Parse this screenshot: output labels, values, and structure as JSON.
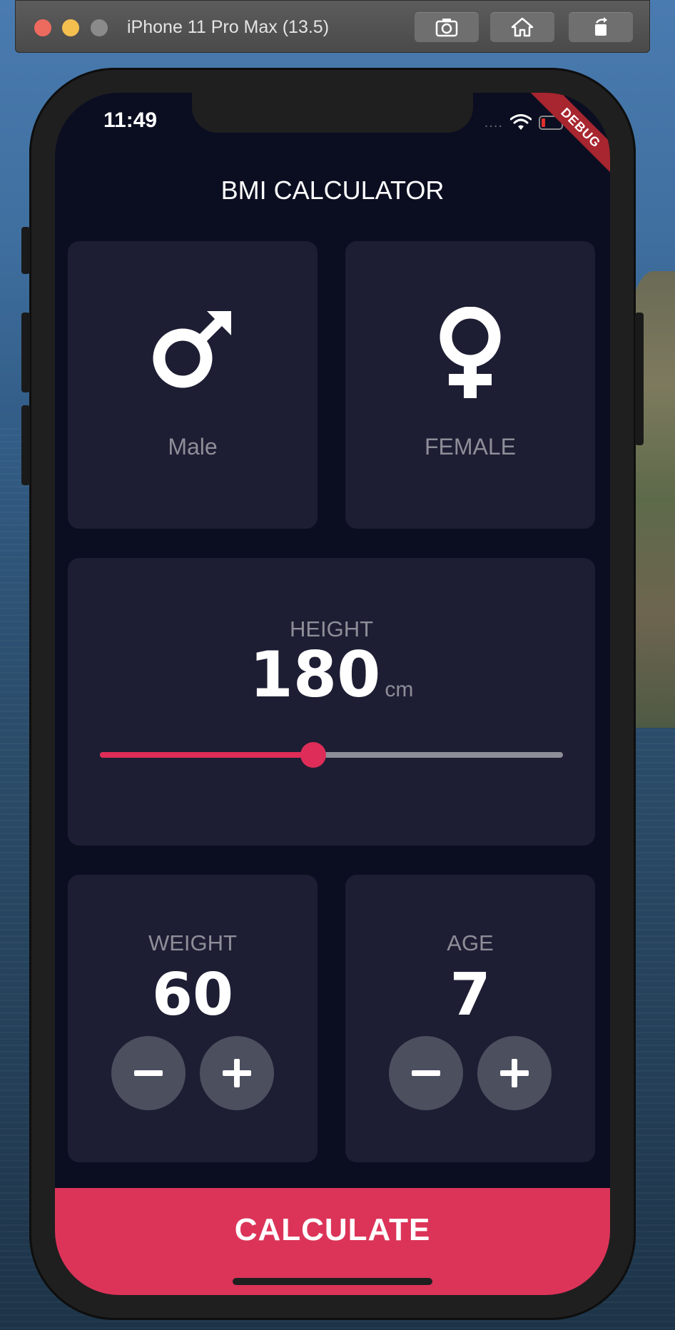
{
  "simulator": {
    "title": "iPhone 11 Pro Max (13.5)",
    "buttons": [
      "screenshot-icon",
      "home-icon",
      "rotate-icon"
    ]
  },
  "status_bar": {
    "time": "11:49",
    "signal": "....",
    "debug": "DEBUG"
  },
  "app": {
    "title": "BMI CALCULATOR",
    "male_label": "Male",
    "female_label": "FEMALE",
    "height": {
      "label": "HEIGHT",
      "value": "180",
      "unit": "cm",
      "slider_fraction": 0.46
    },
    "weight": {
      "label": "WEIGHT",
      "value": "60"
    },
    "age": {
      "label": "AGE",
      "value": "7"
    },
    "calculate_label": "CALCULATE"
  },
  "colors": {
    "background": "#0b0e21",
    "card": "#1d1e33",
    "accent": "#de2d58",
    "label": "#8d8e98",
    "round_button": "#4c4f5e"
  }
}
